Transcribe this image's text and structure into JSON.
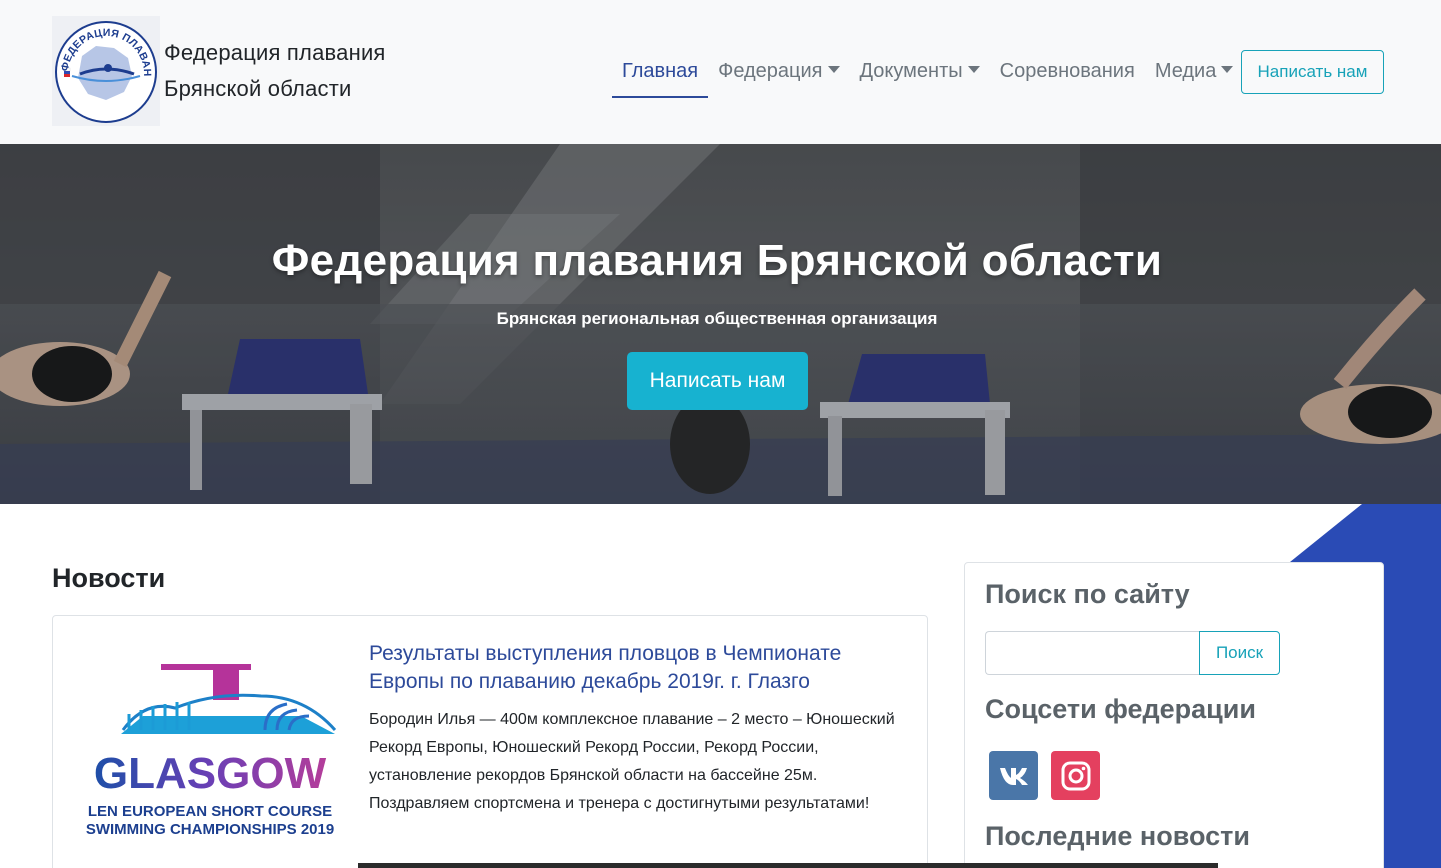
{
  "brand": {
    "line1": "Федерация плавания",
    "line2": "Брянской области",
    "logo_ring_text": "ФЕДЕРАЦИЯ ПЛАВАНИЯ БРЯНСКОЙ ОБЛАСТИ"
  },
  "nav": {
    "items": [
      {
        "label": "Главная",
        "active": true,
        "dropdown": false
      },
      {
        "label": "Федерация",
        "active": false,
        "dropdown": true
      },
      {
        "label": "Документы",
        "active": false,
        "dropdown": true
      },
      {
        "label": "Соревнования",
        "active": false,
        "dropdown": false
      },
      {
        "label": "Медиа",
        "active": false,
        "dropdown": true
      }
    ],
    "cta_label": "Написать нам"
  },
  "hero": {
    "title": "Федерация плавания Брянской области",
    "subtitle": "Брянская региональная общественная организация",
    "button_label": "Написать нам"
  },
  "news": {
    "heading": "Новости",
    "items": [
      {
        "title": "Результаты выступления пловцов в Чемпионате Европы по плаванию декабрь 2019г. г. Глазго",
        "body": "Бородин Илья — 400м комплексное плавание – 2 место – Юношеский Рекорд Европы, Юношеский Рекорд России, Рекорд России, установление рекордов Брянской области на бассейне 25м. Поздравляем спортсмена и тренера с достигнутыми результатами!",
        "image": {
          "logo_word": "GLASGOW",
          "caption_line1": "LEN EUROPEAN SHORT COURSE",
          "caption_line2": "SWIMMING CHAMPIONSHIPS 2019"
        }
      }
    ]
  },
  "sidebar": {
    "search_heading": "Поиск по сайту",
    "search_value": "",
    "search_button": "Поиск",
    "social_heading": "Соцсети федерации",
    "social_links": [
      {
        "name": "vk",
        "icon": "vk-icon",
        "color": "#4a76a8"
      },
      {
        "name": "instagram",
        "icon": "instagram-icon",
        "color": "#e4405f"
      }
    ],
    "latest_heading": "Последние новости"
  },
  "colors": {
    "primary": "#2d4a9a",
    "accent": "#17a2b8",
    "hero_button": "#17b2d0",
    "deco_blue": "#2a4bb5"
  }
}
